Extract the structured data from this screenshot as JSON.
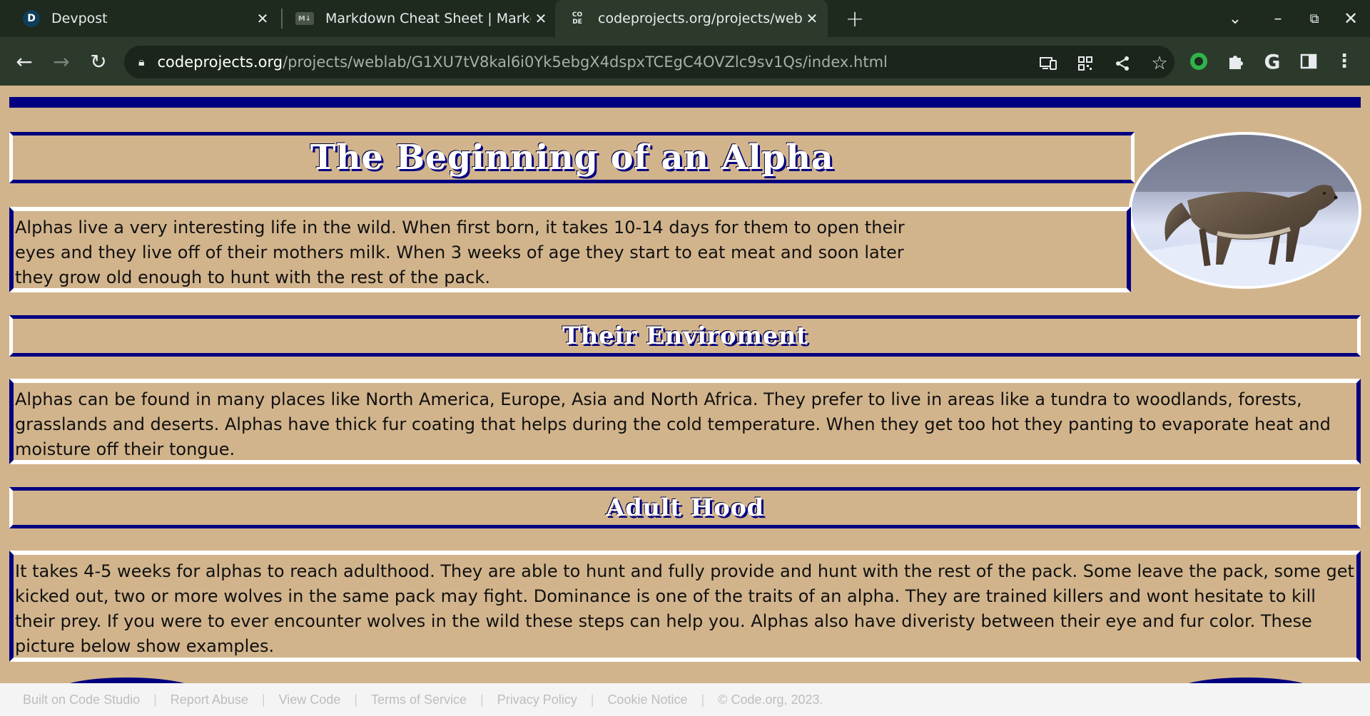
{
  "browser": {
    "tabs": [
      {
        "title": "Devpost",
        "favicon": "D"
      },
      {
        "title": "Markdown Cheat Sheet | Markdown",
        "favicon": "M↓"
      },
      {
        "title": "codeprojects.org/projects/weblab",
        "favicon": "CO DE"
      }
    ],
    "new_tab_label": "+",
    "url_host": "codeprojects.org",
    "url_path": "/projects/weblab/G1XU7tV8kal6i0Yk5ebgX4dspxTCEgC4OVZlc9sv1Qs/index.html",
    "icons": {
      "back": "arrow-left-icon",
      "forward": "arrow-right-icon",
      "reload": "reload-icon",
      "lock": "lock-icon",
      "cast": "cast-icon",
      "qr": "qr-code-icon",
      "share": "share-icon",
      "bookmark": "star-icon",
      "extension_green": "green-circle-extension-icon",
      "extensions": "puzzle-icon",
      "grammarly": "g-extension-icon",
      "sidepanel": "side-panel-icon",
      "menu": "kebab-menu-icon"
    },
    "colors": {
      "tabbar": "#1e2a1e",
      "toolbar": "#2c3a2c",
      "omnibox": "#1b251b"
    }
  },
  "page": {
    "title": "The Beginning of an Alpha",
    "intro": "Alphas live a very interesting life in the wild. When first born, it takes 10-14 days for them to open their eyes and they live off of their mothers milk. When 3 weeks of age they start to eat meat and soon later they grow old enough to hunt with the rest of the pack.",
    "section1_title": "Their Enviroment",
    "section1_text": "Alphas can be found in many places like North America, Europe, Asia and North Africa. They prefer to live in areas like a tundra to woodlands, forests, grasslands and deserts. Alphas have thick fur coating that helps during the cold temperature. When they get too hot they panting to evaporate heat and moisture off their tongue.",
    "section2_title": "Adult Hood",
    "section2_text": "It takes 4-5 weeks for alphas to reach adulthood. They are able to hunt and fully provide and hunt with the rest of the pack. Some leave the pack, some get kicked out, two or more wolves in the same pack may fight. Dominance is one of the traits of an alpha. They are trained killers and wont hesitate to kill their prey. If you were to ever encounter wolves in the wild these steps can help you. Alphas also have diveristy between their eye and fur color. These picture below show examples.",
    "colors": {
      "background": "#d2b48c",
      "accent": "#000080",
      "heading_text": "#ffffff"
    }
  },
  "footer": {
    "links": [
      "Built on Code Studio",
      "Report Abuse",
      "View Code",
      "Terms of Service",
      "Privacy Policy",
      "Cookie Notice"
    ],
    "copyright": "© Code.org, 2023."
  }
}
